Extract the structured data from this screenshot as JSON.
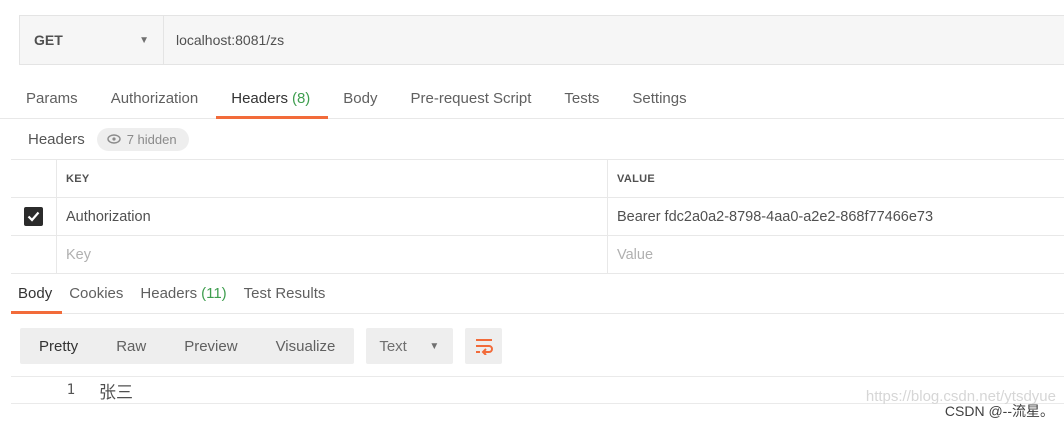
{
  "request": {
    "method": "GET",
    "url": "localhost:8081/zs"
  },
  "request_tabs": [
    {
      "label": "Params",
      "count": ""
    },
    {
      "label": "Authorization",
      "count": ""
    },
    {
      "label": "Headers",
      "count": "(8)"
    },
    {
      "label": "Body",
      "count": ""
    },
    {
      "label": "Pre-request Script",
      "count": ""
    },
    {
      "label": "Tests",
      "count": ""
    },
    {
      "label": "Settings",
      "count": ""
    }
  ],
  "headers_section": {
    "label": "Headers",
    "hidden_label": "7 hidden"
  },
  "table": {
    "key_header": "KEY",
    "value_header": "VALUE",
    "rows": [
      {
        "key": "Authorization",
        "value": "Bearer fdc2a0a2-8798-4aa0-a2e2-868f77466e73",
        "checked": true
      }
    ],
    "key_placeholder": "Key",
    "value_placeholder": "Value"
  },
  "response_tabs": [
    {
      "label": "Body",
      "count": ""
    },
    {
      "label": "Cookies",
      "count": ""
    },
    {
      "label": "Headers",
      "count": "(11)"
    },
    {
      "label": "Test Results",
      "count": ""
    }
  ],
  "format": {
    "modes": [
      "Pretty",
      "Raw",
      "Preview",
      "Visualize"
    ],
    "type": "Text"
  },
  "response_body": {
    "line": "1",
    "text": "张三"
  },
  "watermark": "https://blog.csdn.net/ytsdyue",
  "credit": "CSDN @--流星。",
  "colors": {
    "accent": "#f26b3a",
    "count_green": "#3f9e4f"
  }
}
